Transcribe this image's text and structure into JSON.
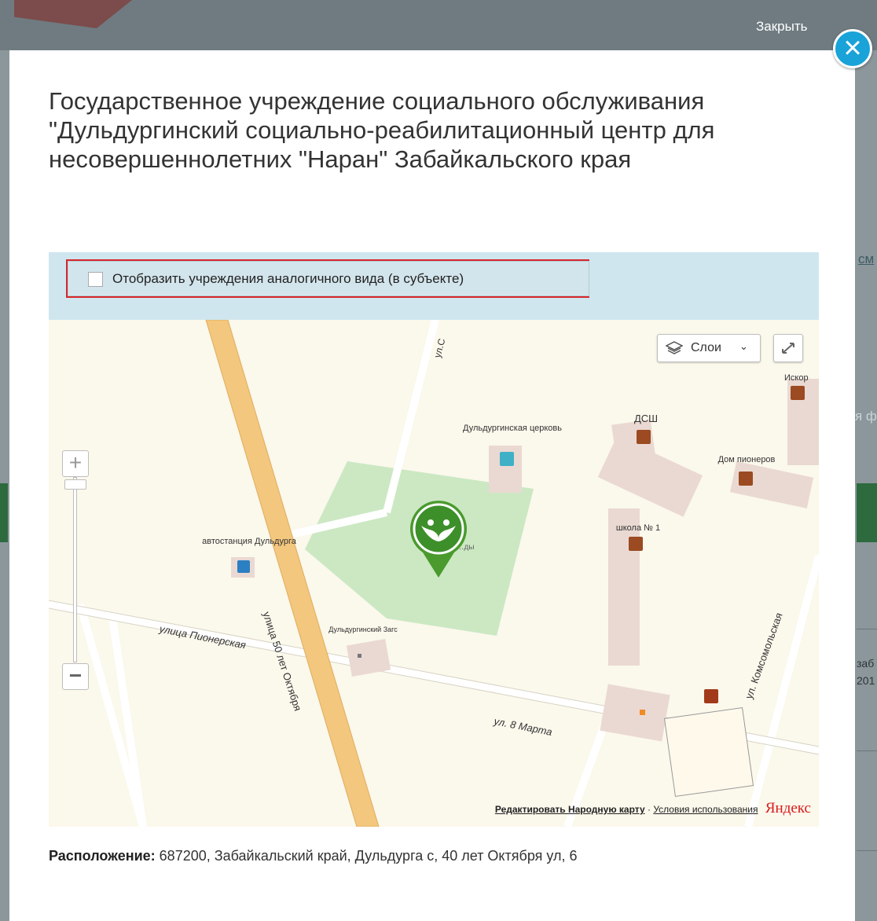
{
  "header": {
    "close_label": "Закрыть",
    "close_icon": "×"
  },
  "modal": {
    "title": "Государственное учреждение социального обслуживания \"Дульдургинский социально-реабилитационный центр для несовершеннолетних \"Наран\" Забайкальского края"
  },
  "filter": {
    "checkbox_label": "Отобразить учреждения аналогичного вида (в субъекте)",
    "checked": false
  },
  "map": {
    "layers_label": "Слои",
    "labels": {
      "street_50": "улица 50 лет Октября",
      "street_pioneer": "улица Пионерская",
      "street_8march": "ул. 8 Марта",
      "street_komsomol": "ул. Комсомольская",
      "street_s": "ул.С",
      "church": "Дульдургинская церковь",
      "bus": "автостанция Дульдурга",
      "zags": "Дульдургинский Загс",
      "dsh": "ДСШ",
      "pioneers": "Дом пионеров",
      "school": "школа № 1",
      "iskor": "Искор",
      "park_fragment": "…ды"
    },
    "copyright": {
      "edit_link": "Редактировать Народную карту",
      "separator": "·",
      "terms_link": "Условия использования",
      "logo": "Яндекс"
    }
  },
  "address": {
    "label": "Расположение:",
    "value": "687200, Забайкальский край, Дульдурга с, 40 лет Октября ул, 6"
  },
  "background": {
    "fragment_1": "см",
    "fragment_2": "я ф",
    "fragment_3": "заб",
    "fragment_4": "201"
  },
  "colors": {
    "accent": "#19a3d8",
    "marker": "#4a9a2e",
    "highlight": "#d6262b",
    "main_road": "#f3c77e"
  }
}
